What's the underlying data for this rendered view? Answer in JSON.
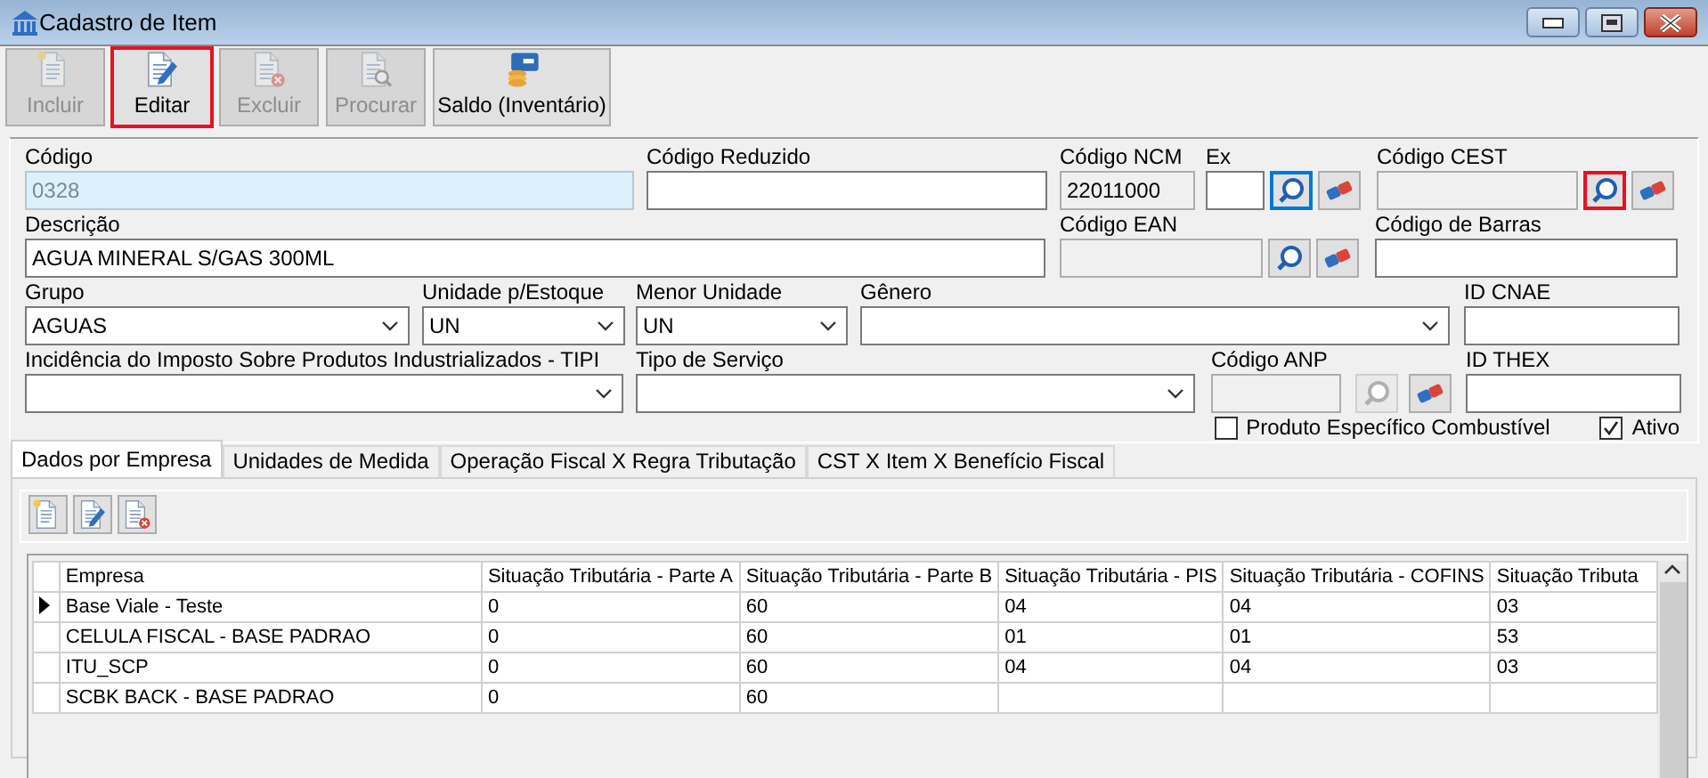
{
  "window": {
    "title": "Cadastro de Item"
  },
  "toolbar": [
    {
      "label": "Incluir",
      "kind": "new",
      "disabled": true,
      "highlighted": false
    },
    {
      "label": "Editar",
      "kind": "edit",
      "disabled": false,
      "highlighted": true
    },
    {
      "label": "Excluir",
      "kind": "delete",
      "disabled": true,
      "highlighted": false
    },
    {
      "label": "Procurar",
      "kind": "find",
      "disabled": true,
      "highlighted": false
    },
    {
      "label": "Saldo (Inventário)",
      "kind": "balance",
      "disabled": false,
      "highlighted": false
    }
  ],
  "form": {
    "groups": [
      {
        "fields": [
          {
            "kind": "text",
            "label": "Código",
            "value": "0328",
            "readonly": true,
            "disabled": false
          },
          {
            "kind": "text",
            "label": "Código Reduzido",
            "readonly": false,
            "disabled": false
          },
          {
            "kind": "text",
            "label": "Código NCM",
            "value": "22011000",
            "readonly": false,
            "disabled": true
          },
          {
            "kind": "text",
            "label": "Ex",
            "readonly": false,
            "disabled": false
          },
          {
            "kind": "search",
            "disabled": false,
            "focused": true,
            "highlighted": false
          },
          {
            "kind": "eraser"
          },
          {
            "kind": "text",
            "label": "Código CEST",
            "readonly": false,
            "disabled": true
          },
          {
            "kind": "search",
            "disabled": false,
            "focused": false,
            "highlighted": true
          },
          {
            "kind": "eraser"
          }
        ]
      },
      {
        "fields": [
          {
            "kind": "text",
            "label": "Descrição",
            "value": "AGUA MINERAL S/GAS 300ML",
            "readonly": false,
            "disabled": false
          },
          {
            "kind": "text",
            "label": "Código EAN",
            "readonly": false,
            "disabled": true
          },
          {
            "kind": "search",
            "disabled": false,
            "focused": false,
            "highlighted": false
          },
          {
            "kind": "eraser"
          },
          {
            "kind": "text",
            "label": "Código de Barras",
            "readonly": false,
            "disabled": false
          }
        ]
      },
      {
        "fields": [
          {
            "kind": "combo",
            "label": "Grupo",
            "value": "AGUAS"
          },
          {
            "kind": "combo",
            "label": "Unidade p/Estoque",
            "value": "UN"
          },
          {
            "kind": "combo",
            "label": "Menor Unidade",
            "value": "UN"
          },
          {
            "kind": "combo",
            "label": "Gênero"
          },
          {
            "kind": "text",
            "label": "ID CNAE",
            "readonly": false,
            "disabled": false
          }
        ]
      },
      {
        "fields": [
          {
            "kind": "combo",
            "label": "Incidência do Imposto Sobre Produtos Industrializados - TIPI"
          },
          {
            "kind": "combo",
            "label": "Tipo de Serviço"
          },
          {
            "kind": "text",
            "label": "Código ANP",
            "readonly": false,
            "disabled": true
          },
          {
            "kind": "search",
            "disabled": true,
            "focused": false,
            "highlighted": false
          },
          {
            "kind": "eraser"
          },
          {
            "kind": "text",
            "label": "ID THEX",
            "readonly": false,
            "disabled": false
          }
        ]
      }
    ],
    "options": [
      {
        "label": "Produto Específico Combustível",
        "checked": false
      },
      {
        "label": "Ativo",
        "checked": true
      }
    ]
  },
  "tabs": [
    {
      "label": "Dados por Empresa",
      "selected": true
    },
    {
      "label": "Unidades de Medida",
      "selected": false
    },
    {
      "label": "Operação Fiscal X Regra Tributação",
      "selected": false
    },
    {
      "label": "CST X Item X Benefício Fiscal",
      "selected": false
    }
  ],
  "grid_toolbar": [
    {
      "kind": "new"
    },
    {
      "kind": "edit"
    },
    {
      "kind": "delete"
    }
  ],
  "table": {
    "columns": [
      "Empresa",
      "Situação Tributária - Parte A",
      "Situação Tributária - Parte B",
      "Situação Tributária - PIS",
      "Situação Tributária - COFINS",
      "Situação Tributa"
    ],
    "rows": [
      {
        "current": true,
        "cells": [
          "Base Viale - Teste",
          "0",
          "60",
          "04",
          "04",
          "03"
        ]
      },
      {
        "current": false,
        "cells": [
          "CELULA FISCAL - BASE PADRAO",
          "0",
          "60",
          "01",
          "01",
          "53"
        ]
      },
      {
        "current": false,
        "cells": [
          "ITU_SCP",
          "0",
          "60",
          "04",
          "04",
          "03"
        ]
      },
      {
        "current": false,
        "cells": [
          "SCBK BACK - BASE PADRAO",
          "0",
          "60",
          "",
          "",
          ""
        ]
      }
    ]
  }
}
